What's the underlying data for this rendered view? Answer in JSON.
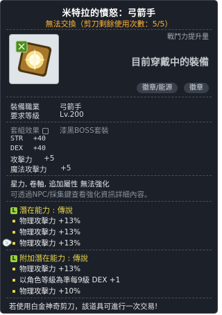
{
  "tooltip": {
    "title": "米特拉的憤怒：弓箭手",
    "subtitle": "無法交換（剪刀剩餘使用次數：5/5）",
    "combat_power_label": "戰鬥力提升量",
    "equipped_label": "目前穿戴中的裝備",
    "tags": [
      "徽章/能源",
      "徽章"
    ],
    "requirements": [
      {
        "label": "裝備職業",
        "value": "弓箭手"
      },
      {
        "label": "要求等級",
        "value": "Lv.200"
      }
    ],
    "set_effect": {
      "label": "套組效果",
      "value": "漆黑BOSS套裝"
    },
    "stats": [
      {
        "label": "STR",
        "value": "+40"
      },
      {
        "label": "DEX",
        "value": "+40"
      },
      {
        "label": "攻擊力",
        "value": "+5"
      },
      {
        "label": "魔法攻擊力",
        "value": "+5"
      }
    ],
    "notes": [
      "星力, 卷軸, 追加屬性 無法強化",
      "可透過NPC/採集鍵查看強化資訊詳細內容。"
    ],
    "potential": {
      "badge": "L",
      "title": "潛在能力 : 傳說",
      "lines": [
        "物理攻擊力 +13%",
        "物理攻擊力 +13%",
        "物理攻擊力 +13%"
      ]
    },
    "additional_potential": {
      "badge": "L",
      "title": "附加潛在能力 : 傳說",
      "lines": [
        "物理攻擊力 +13%",
        "以角色等級為準每9級 DEX +1",
        "物理攻擊力 +10%"
      ]
    },
    "footer": "若使用白金神奇剪刀，該道具可進行一次交易!"
  }
}
